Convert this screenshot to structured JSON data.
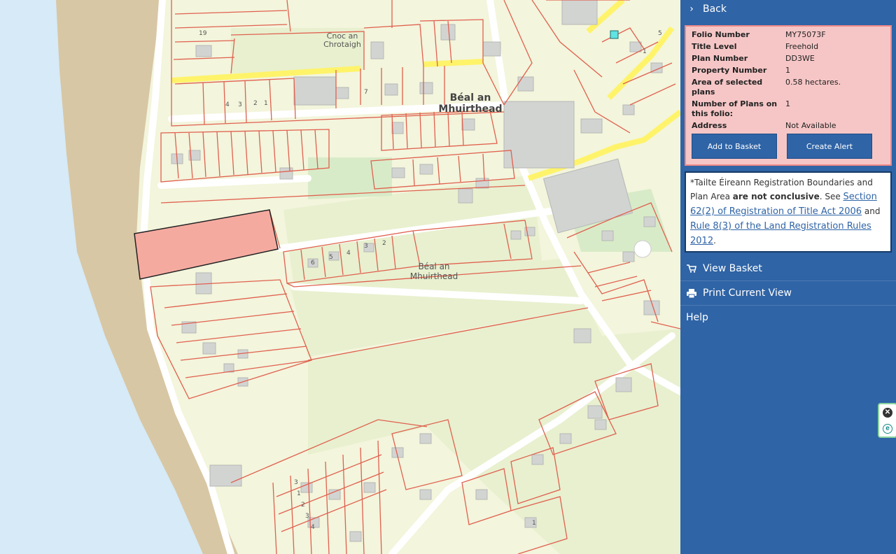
{
  "map": {
    "labels": {
      "cnoc": "Cnoc an\nChrotaigh",
      "beal_top": "Béal an\nMhuirthead",
      "beal_mid": "Béal an\nMhuirthead"
    },
    "house_numbers": [
      "19",
      "4",
      "3",
      "2",
      "1",
      "7",
      "5",
      "6",
      "4",
      "3",
      "2",
      "1",
      "5",
      "3",
      "1",
      "2",
      "3",
      "4",
      "1"
    ],
    "colors": {
      "sea": "#d6eaf7",
      "beach": "#d8c7a4",
      "land": "#f3f5dc",
      "boundary": "#e0604f",
      "selected_parcel": "#f5aaa0",
      "road_highlight": "#fff36a",
      "building": "#d2d4d2"
    }
  },
  "panel": {
    "back_label": "Back",
    "fields": [
      {
        "label": "Folio Number",
        "value": "MY75073F"
      },
      {
        "label": "Title Level",
        "value": "Freehold"
      },
      {
        "label": "Plan Number",
        "value": "DD3WE"
      },
      {
        "label": "Property Number",
        "value": "1"
      },
      {
        "label": "Area of selected plans",
        "value": "0.58 hectares."
      },
      {
        "label": "Number of Plans on this folio:",
        "value": "1"
      },
      {
        "label": "Address",
        "value": "Not Available"
      }
    ],
    "add_to_basket": "Add to Basket",
    "create_alert": "Create Alert",
    "disclaimer": {
      "prefix": "*Tailte Éireann Registration Boundaries and Plan Area ",
      "bold": "are not conclusive",
      "mid": ". See ",
      "link1": "Section 62(2) of Registration of Title Act 2006",
      "and": " and ",
      "link2": "Rule 8(3) of the Land Registration Rules 2012",
      "end": "."
    },
    "view_basket": "View Basket",
    "print_view": "Print Current View",
    "help": "Help"
  },
  "side_tab": {
    "close_symbol": "✕",
    "e_symbol": "e"
  }
}
